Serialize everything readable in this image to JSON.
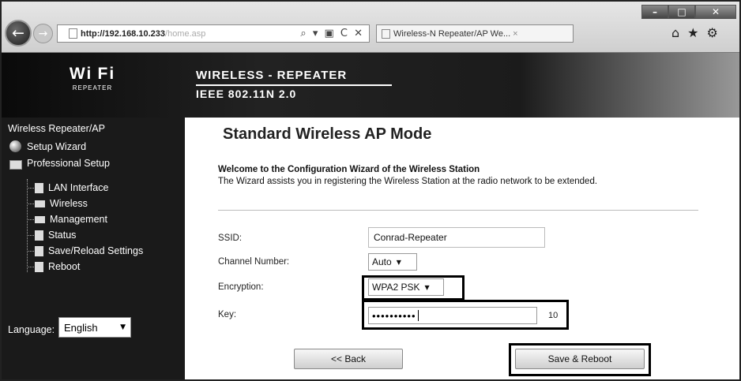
{
  "browser": {
    "url_host": "http://192.168.10.233",
    "url_path": "/home.asp",
    "addr_tools": "⌕ ▾ ▣ C ✕",
    "tab_title": "Wireless-N Repeater/AP We...",
    "tab_close": "×",
    "window_controls": {
      "minimize": "–",
      "maximize": "□",
      "close": "✕"
    },
    "tool_icons": [
      "home-icon",
      "favorites-star-icon",
      "settings-gear-icon"
    ],
    "tool_glyphs": {
      "home": "⌂",
      "star": "★",
      "gear": "⚙"
    },
    "nav_glyphs": {
      "back": "←",
      "forward": "→"
    }
  },
  "header": {
    "logo_text": "Wi Fi",
    "logo_sub": "REPEATER",
    "brand_title": "WIRELESS - REPEATER",
    "brand_sub": "IEEE 802.11N 2.0"
  },
  "sidebar": {
    "title": "Wireless Repeater/AP",
    "setup_wizard": "Setup Wizard",
    "professional_setup": "Professional Setup",
    "items": [
      {
        "label": "LAN Interface",
        "icon": "page-icon"
      },
      {
        "label": "Wireless",
        "icon": "folder-icon"
      },
      {
        "label": "Management",
        "icon": "folder-icon"
      },
      {
        "label": "Status",
        "icon": "page-icon"
      },
      {
        "label": "Save/Reload Settings",
        "icon": "page-icon"
      },
      {
        "label": "Reboot",
        "icon": "page-icon"
      }
    ],
    "language_label": "Language:",
    "language_value": "English"
  },
  "main": {
    "title": "Standard Wireless AP Mode",
    "welcome_title": "Welcome to the Configuration Wizard of the Wireless Station",
    "welcome_text": "The Wizard assists you in registering the Wireless Station at the radio network to be extended.",
    "fields": {
      "ssid_label": "SSID:",
      "ssid_value": "Conrad-Repeater",
      "channel_label": "Channel Number:",
      "channel_value": "Auto",
      "encryption_label": "Encryption:",
      "encryption_value": "WPA2 PSK",
      "key_label": "Key:",
      "key_value": "••••••••••",
      "key_count": "10"
    },
    "back_button": "<< Back",
    "save_button": "Save & Reboot"
  }
}
